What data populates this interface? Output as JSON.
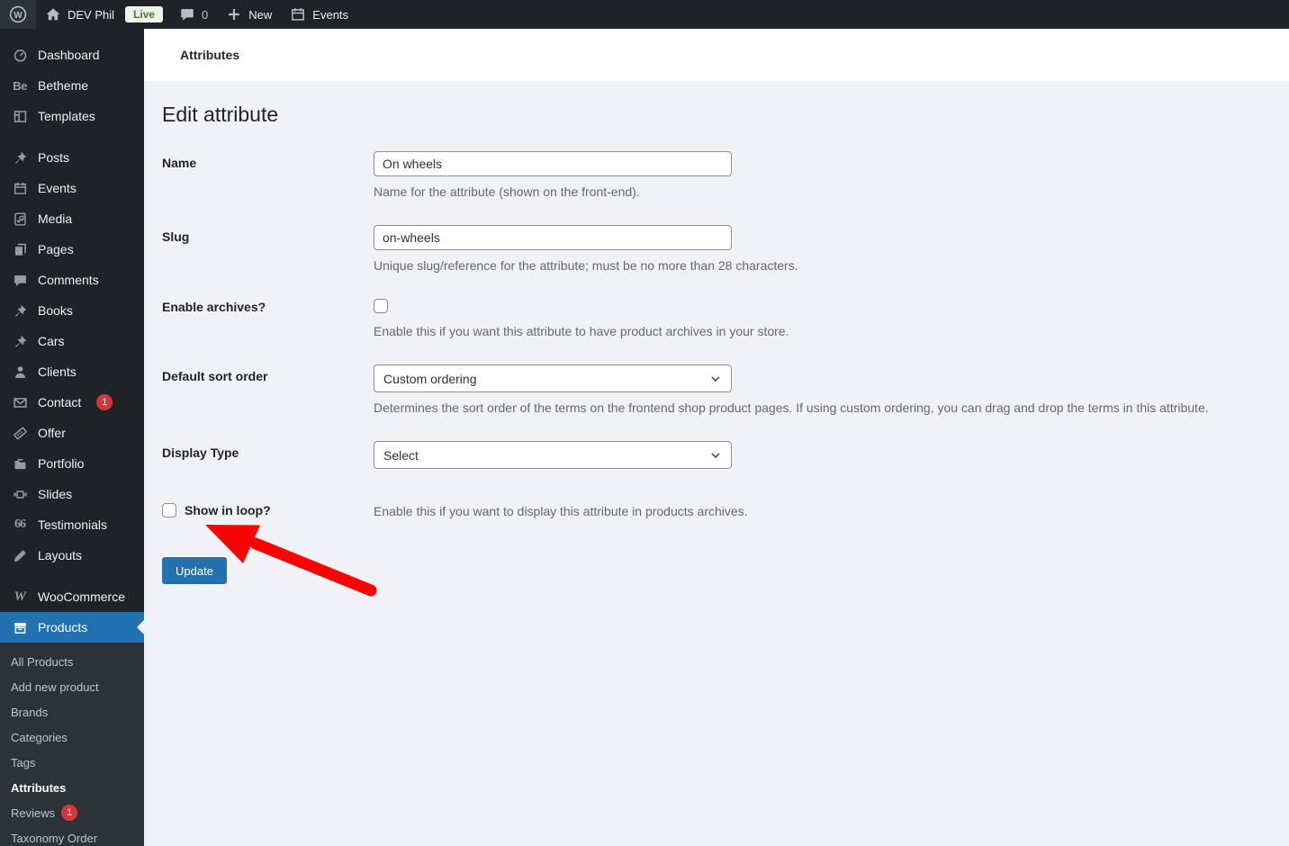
{
  "admin_bar": {
    "wordpress_logo": "wordpress-icon",
    "site_name": "DEV Phil",
    "live_badge": "Live",
    "comment_count": "0",
    "new_label": "New",
    "events_label": "Events"
  },
  "sidebar": {
    "items": [
      {
        "label": "Dashboard",
        "icon": "dashboard-icon"
      },
      {
        "label": "Betheme",
        "icon": "betheme-icon"
      },
      {
        "label": "Templates",
        "icon": "templates-icon",
        "separator_after": true
      },
      {
        "label": "Posts",
        "icon": "pin-icon"
      },
      {
        "label": "Events",
        "icon": "calendar-icon"
      },
      {
        "label": "Media",
        "icon": "media-icon"
      },
      {
        "label": "Pages",
        "icon": "pages-icon"
      },
      {
        "label": "Comments",
        "icon": "comment-icon"
      },
      {
        "label": "Books",
        "icon": "pin-icon"
      },
      {
        "label": "Cars",
        "icon": "pin-icon"
      },
      {
        "label": "Clients",
        "icon": "user-icon"
      },
      {
        "label": "Contact",
        "icon": "envelope-icon",
        "badge": "1"
      },
      {
        "label": "Offer",
        "icon": "ticket-icon"
      },
      {
        "label": "Portfolio",
        "icon": "portfolio-icon"
      },
      {
        "label": "Slides",
        "icon": "slides-icon"
      },
      {
        "label": "Testimonials",
        "icon": "quote-icon"
      },
      {
        "label": "Layouts",
        "icon": "pencil-icon",
        "separator_after": true
      },
      {
        "label": "WooCommerce",
        "icon": "woocommerce-icon"
      },
      {
        "label": "Products",
        "icon": "products-icon",
        "active": true
      }
    ],
    "submenu_items": [
      {
        "label": "All Products"
      },
      {
        "label": "Add new product"
      },
      {
        "label": "Brands"
      },
      {
        "label": "Categories"
      },
      {
        "label": "Tags"
      },
      {
        "label": "Attributes",
        "current": true
      },
      {
        "label": "Reviews",
        "badge": "1"
      },
      {
        "label": "Taxonomy Order"
      }
    ]
  },
  "header": {
    "title": "Attributes"
  },
  "main": {
    "title": "Edit attribute",
    "fields": {
      "name": {
        "label": "Name",
        "value": "On wheels",
        "description": "Name for the attribute (shown on the front-end)."
      },
      "slug": {
        "label": "Slug",
        "value": "on-wheels",
        "description": "Unique slug/reference for the attribute; must be no more than 28 characters."
      },
      "enable_archives": {
        "label": "Enable archives?",
        "checked": false,
        "description": "Enable this if you want this attribute to have product archives in your store."
      },
      "default_sort_order": {
        "label": "Default sort order",
        "value": "Custom ordering",
        "description": "Determines the sort order of the terms on the frontend shop product pages. If using custom ordering, you can drag and drop the terms in this attribute."
      },
      "display_type": {
        "label": "Display Type",
        "value": "Select"
      },
      "show_in_loop": {
        "label": "Show in loop?",
        "checked": false,
        "description": "Enable this if you want to display this attribute in products archives."
      }
    },
    "update_button": "Update"
  },
  "colors": {
    "accent_blue": "#2271b1",
    "badge_red": "#d63638",
    "arrow_red": "#f70404",
    "live_badge_bg": "#eef6ea",
    "live_badge_text": "#3c7a36",
    "sidebar_bg": "#1d2327",
    "submenu_bg": "#2c3338",
    "content_bg": "#f0f2f5"
  }
}
